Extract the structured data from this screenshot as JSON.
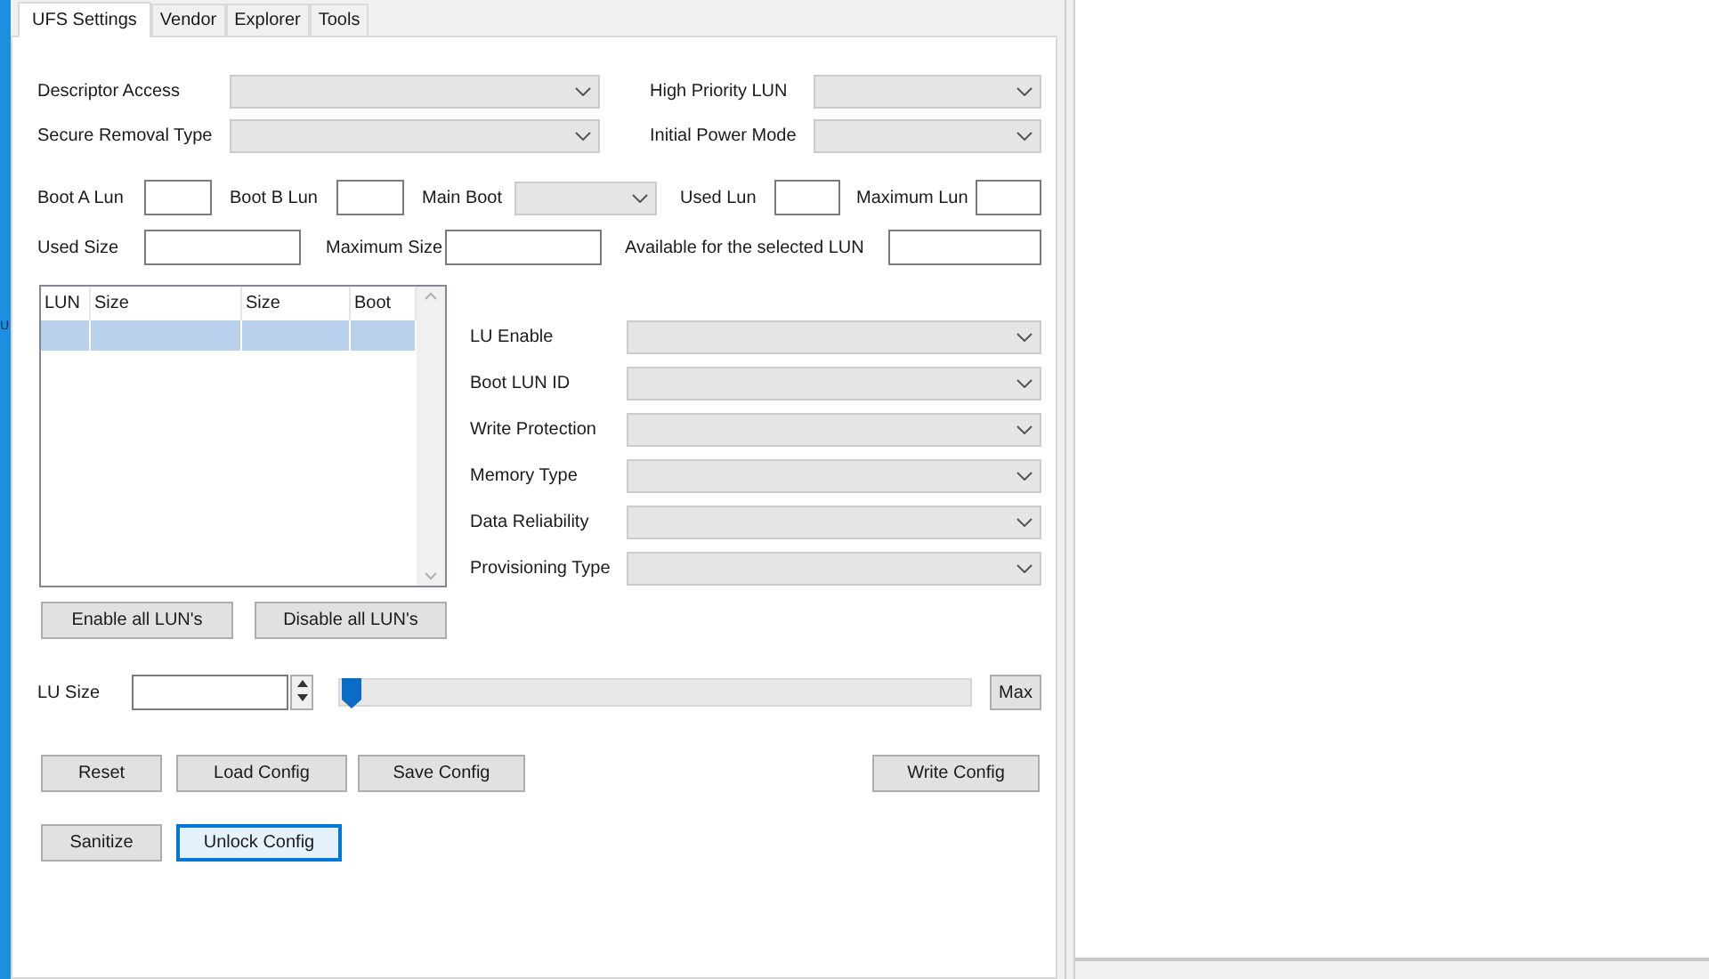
{
  "edge_text": "U",
  "tabs": [
    {
      "label": "UFS Settings",
      "selected": true
    },
    {
      "label": "Vendor",
      "selected": false
    },
    {
      "label": "Explorer",
      "selected": false
    },
    {
      "label": "Tools",
      "selected": false
    }
  ],
  "descriptor_access": {
    "label": "Descriptor Access"
  },
  "secure_removal_type": {
    "label": "Secure Removal Type"
  },
  "high_priority_lun": {
    "label": "High Priority LUN"
  },
  "initial_power_mode": {
    "label": "Initial Power Mode"
  },
  "boot_a_lun": {
    "label": "Boot A Lun"
  },
  "boot_b_lun": {
    "label": "Boot B Lun"
  },
  "main_boot": {
    "label": "Main Boot"
  },
  "used_lun": {
    "label": "Used Lun"
  },
  "maximum_lun": {
    "label": "Maximum Lun"
  },
  "used_size": {
    "label": "Used Size"
  },
  "maximum_size": {
    "label": "Maximum Size"
  },
  "available": {
    "label": "Available for the selected LUN"
  },
  "lun_table": {
    "columns": [
      "LUN",
      "Size",
      "Size",
      "Boot"
    ],
    "rows": [
      {
        "selected": true
      }
    ]
  },
  "lu_fields": [
    {
      "label": "LU Enable"
    },
    {
      "label": "Boot LUN ID"
    },
    {
      "label": "Write Protection"
    },
    {
      "label": "Memory Type"
    },
    {
      "label": "Data Reliability"
    },
    {
      "label": "Provisioning Type"
    }
  ],
  "lun_buttons": [
    "Enable all LUN's",
    "Disable all LUN's"
  ],
  "lu_size": {
    "label": "LU Size",
    "level": 0,
    "max_button": "Max"
  },
  "buttons_row_1": [
    {
      "label": "Reset",
      "focused": false
    },
    {
      "label": "Load Config",
      "focused": false
    },
    {
      "label": "Save Config",
      "focused": false
    },
    {
      "label": "Write Config",
      "focused": false
    }
  ],
  "buttons_row_2": [
    {
      "label": "Sanitize",
      "focused": false
    },
    {
      "label": "Unlock Config",
      "focused": true
    }
  ]
}
